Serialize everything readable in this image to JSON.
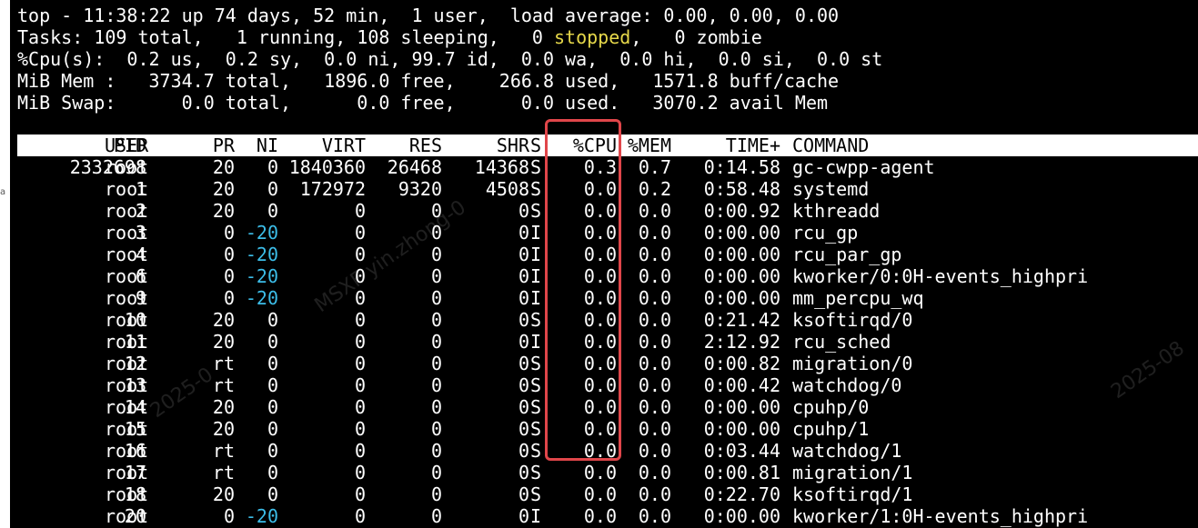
{
  "summary": {
    "line1": "top - 11:38:22 up 74 days, 52 min,  1 user,  load average: 0.00, 0.00, 0.00",
    "line2a": "Tasks: 109 total,   1 running, 108 sleeping,   0 ",
    "line2b": "stopped",
    "line2c": ",   0 zombie",
    "line3": "%Cpu(s):  0.2 us,  0.2 sy,  0.0 ni, 99.7 id,  0.0 wa,  0.0 hi,  0.0 si,  0.0 st",
    "line4": "MiB Mem :   3734.7 total,   1896.0 free,    266.8 used,   1571.8 buff/cache",
    "line5": "MiB Swap:      0.0 total,      0.0 free,      0.0 used.   3070.2 avail Mem"
  },
  "columns": {
    "pid": "PID",
    "user": "USER",
    "pr": "PR",
    "ni": "NI",
    "virt": "VIRT",
    "res": "RES",
    "shr": "SHR",
    "s": "S",
    "cpu": "%CPU",
    "mem": "%MEM",
    "time": "TIME+",
    "command": "COMMAND"
  },
  "processes": [
    {
      "pid": "2332698",
      "user": "root",
      "pr": "20",
      "ni": "0",
      "virt": "1840360",
      "res": "26468",
      "shr": "14368",
      "s": "S",
      "cpu": "0.3",
      "mem": "0.7",
      "time": "0:14.58",
      "command": "gc-cwpp-agent"
    },
    {
      "pid": "1",
      "user": "root",
      "pr": "20",
      "ni": "0",
      "virt": "172972",
      "res": "9320",
      "shr": "4508",
      "s": "S",
      "cpu": "0.0",
      "mem": "0.2",
      "time": "0:58.48",
      "command": "systemd"
    },
    {
      "pid": "2",
      "user": "root",
      "pr": "20",
      "ni": "0",
      "virt": "0",
      "res": "0",
      "shr": "0",
      "s": "S",
      "cpu": "0.0",
      "mem": "0.0",
      "time": "0:00.92",
      "command": "kthreadd"
    },
    {
      "pid": "3",
      "user": "root",
      "pr": "0",
      "ni": "-20",
      "virt": "0",
      "res": "0",
      "shr": "0",
      "s": "I",
      "cpu": "0.0",
      "mem": "0.0",
      "time": "0:00.00",
      "command": "rcu_gp"
    },
    {
      "pid": "4",
      "user": "root",
      "pr": "0",
      "ni": "-20",
      "virt": "0",
      "res": "0",
      "shr": "0",
      "s": "I",
      "cpu": "0.0",
      "mem": "0.0",
      "time": "0:00.00",
      "command": "rcu_par_gp"
    },
    {
      "pid": "6",
      "user": "root",
      "pr": "0",
      "ni": "-20",
      "virt": "0",
      "res": "0",
      "shr": "0",
      "s": "I",
      "cpu": "0.0",
      "mem": "0.0",
      "time": "0:00.00",
      "command": "kworker/0:0H-events_highpri"
    },
    {
      "pid": "9",
      "user": "root",
      "pr": "0",
      "ni": "-20",
      "virt": "0",
      "res": "0",
      "shr": "0",
      "s": "I",
      "cpu": "0.0",
      "mem": "0.0",
      "time": "0:00.00",
      "command": "mm_percpu_wq"
    },
    {
      "pid": "10",
      "user": "root",
      "pr": "20",
      "ni": "0",
      "virt": "0",
      "res": "0",
      "shr": "0",
      "s": "S",
      "cpu": "0.0",
      "mem": "0.0",
      "time": "0:21.42",
      "command": "ksoftirqd/0"
    },
    {
      "pid": "11",
      "user": "root",
      "pr": "20",
      "ni": "0",
      "virt": "0",
      "res": "0",
      "shr": "0",
      "s": "I",
      "cpu": "0.0",
      "mem": "0.0",
      "time": "2:12.92",
      "command": "rcu_sched"
    },
    {
      "pid": "12",
      "user": "root",
      "pr": "rt",
      "ni": "0",
      "virt": "0",
      "res": "0",
      "shr": "0",
      "s": "S",
      "cpu": "0.0",
      "mem": "0.0",
      "time": "0:00.82",
      "command": "migration/0"
    },
    {
      "pid": "13",
      "user": "root",
      "pr": "rt",
      "ni": "0",
      "virt": "0",
      "res": "0",
      "shr": "0",
      "s": "S",
      "cpu": "0.0",
      "mem": "0.0",
      "time": "0:00.42",
      "command": "watchdog/0"
    },
    {
      "pid": "14",
      "user": "root",
      "pr": "20",
      "ni": "0",
      "virt": "0",
      "res": "0",
      "shr": "0",
      "s": "S",
      "cpu": "0.0",
      "mem": "0.0",
      "time": "0:00.00",
      "command": "cpuhp/0"
    },
    {
      "pid": "15",
      "user": "root",
      "pr": "20",
      "ni": "0",
      "virt": "0",
      "res": "0",
      "shr": "0",
      "s": "S",
      "cpu": "0.0",
      "mem": "0.0",
      "time": "0:00.00",
      "command": "cpuhp/1"
    },
    {
      "pid": "16",
      "user": "root",
      "pr": "rt",
      "ni": "0",
      "virt": "0",
      "res": "0",
      "shr": "0",
      "s": "S",
      "cpu": "0.0",
      "mem": "0.0",
      "time": "0:03.44",
      "command": "watchdog/1"
    },
    {
      "pid": "17",
      "user": "root",
      "pr": "rt",
      "ni": "0",
      "virt": "0",
      "res": "0",
      "shr": "0",
      "s": "S",
      "cpu": "0.0",
      "mem": "0.0",
      "time": "0:00.81",
      "command": "migration/1"
    },
    {
      "pid": "18",
      "user": "root",
      "pr": "20",
      "ni": "0",
      "virt": "0",
      "res": "0",
      "shr": "0",
      "s": "S",
      "cpu": "0.0",
      "mem": "0.0",
      "time": "0:22.70",
      "command": "ksoftirqd/1"
    },
    {
      "pid": "20",
      "user": "root",
      "pr": "0",
      "ni": "-20",
      "virt": "0",
      "res": "0",
      "shr": "0",
      "s": "I",
      "cpu": "0.0",
      "mem": "0.0",
      "time": "0:00.00",
      "command": "kworker/1:0H-events_highpri"
    }
  ],
  "watermarks": [
    "MSXF yin.zhong-0",
    "2025-0",
    "2025-08"
  ],
  "colors": {
    "terminal_bg": "#000000",
    "text": "#ffffff",
    "stopped_yellow": "#e6d84a",
    "nice_cyan": "#3cbde8",
    "highlight_red": "#e0464a"
  }
}
